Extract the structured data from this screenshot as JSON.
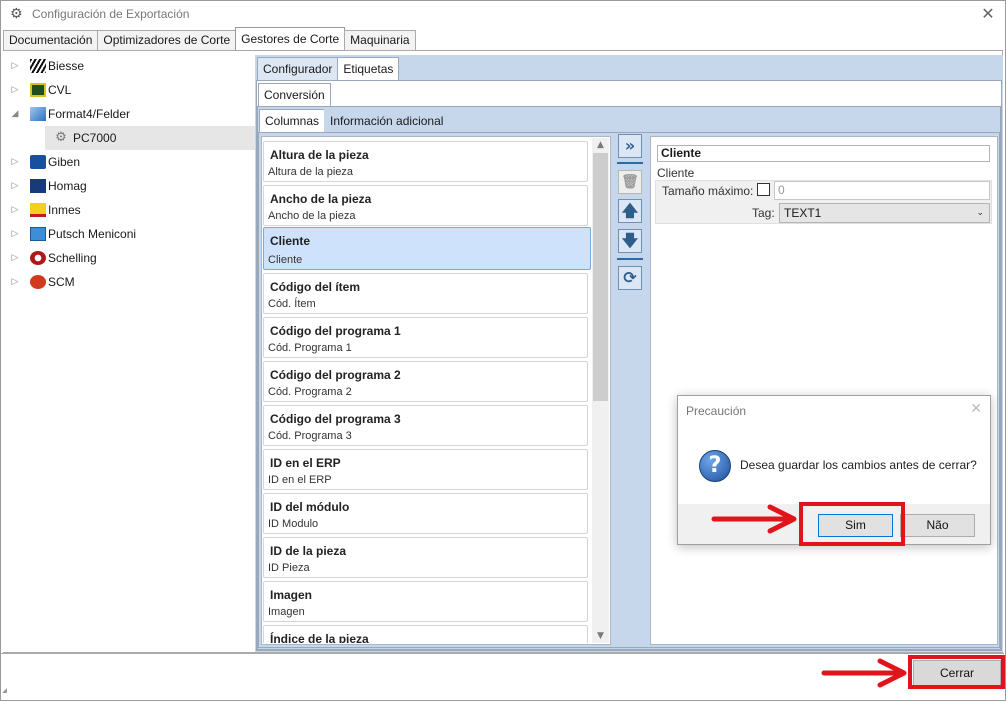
{
  "window": {
    "title": "Configuración de Exportación",
    "close_symbol": "✕"
  },
  "main_tabs": [
    "Documentación",
    "Optimizadores de Corte",
    "Gestores de Corte",
    "Maquinaria"
  ],
  "tree": [
    {
      "label": "Biesse",
      "expander": "▷"
    },
    {
      "label": "CVL",
      "expander": "▷"
    },
    {
      "label": "Format4/Felder",
      "expander": "◢"
    },
    {
      "label": "PC7000",
      "expander": ""
    },
    {
      "label": "Giben",
      "expander": "▷"
    },
    {
      "label": "Homag",
      "expander": "▷"
    },
    {
      "label": "Inmes",
      "expander": "▷"
    },
    {
      "label": "Putsch Meniconi",
      "expander": "▷"
    },
    {
      "label": "Schelling",
      "expander": "▷"
    },
    {
      "label": "SCM",
      "expander": "▷"
    }
  ],
  "tabs_level1": [
    "Configurador",
    "Etiquetas"
  ],
  "tabs_level2": [
    "Conversión"
  ],
  "tabs_level3": [
    "Columnas",
    "Información adicional"
  ],
  "columns": [
    {
      "title": "Altura de la pieza",
      "sub": "Altura de la pieza"
    },
    {
      "title": "Ancho de la pieza",
      "sub": "Ancho de la pieza"
    },
    {
      "title": "Cliente",
      "sub": "Cliente"
    },
    {
      "title": "Código del ítem",
      "sub": "Cód. Ítem"
    },
    {
      "title": "Código del programa 1",
      "sub": "Cód. Programa 1"
    },
    {
      "title": "Código del programa 2",
      "sub": "Cód. Programa 2"
    },
    {
      "title": "Código del programa 3",
      "sub": "Cód. Programa 3"
    },
    {
      "title": "ID en el ERP",
      "sub": "ID en el ERP"
    },
    {
      "title": "ID del módulo",
      "sub": "ID Modulo"
    },
    {
      "title": "ID de la pieza",
      "sub": "ID Pieza"
    },
    {
      "title": "Imagen",
      "sub": "Imagen"
    },
    {
      "title": "Índice de la pieza",
      "sub": ""
    }
  ],
  "toolbar_icons": {
    "add": "»",
    "delete": "🗑",
    "up": "🡅",
    "down": "🡇",
    "refresh": "⟳"
  },
  "scroll": {
    "up": "▲",
    "down": "▼"
  },
  "details": {
    "title": "Cliente",
    "subtitle": "Cliente",
    "max_size_label": "Tamaño máximo:",
    "max_size_value": "0",
    "tag_label": "Tag:",
    "tag_value": "TEXT1",
    "chevron": "⌄"
  },
  "dialog": {
    "title": "Precaución",
    "close_symbol": "✕",
    "icon": "?",
    "message": "Desea guardar los cambios antes de cerrar?",
    "yes_label": "Sim",
    "no_label": "Não"
  },
  "footer": {
    "close_label": "Cerrar"
  },
  "colors": {
    "accent": "#e0151c",
    "selection": "#cfe2fb",
    "panel": "#c6d7ec"
  }
}
